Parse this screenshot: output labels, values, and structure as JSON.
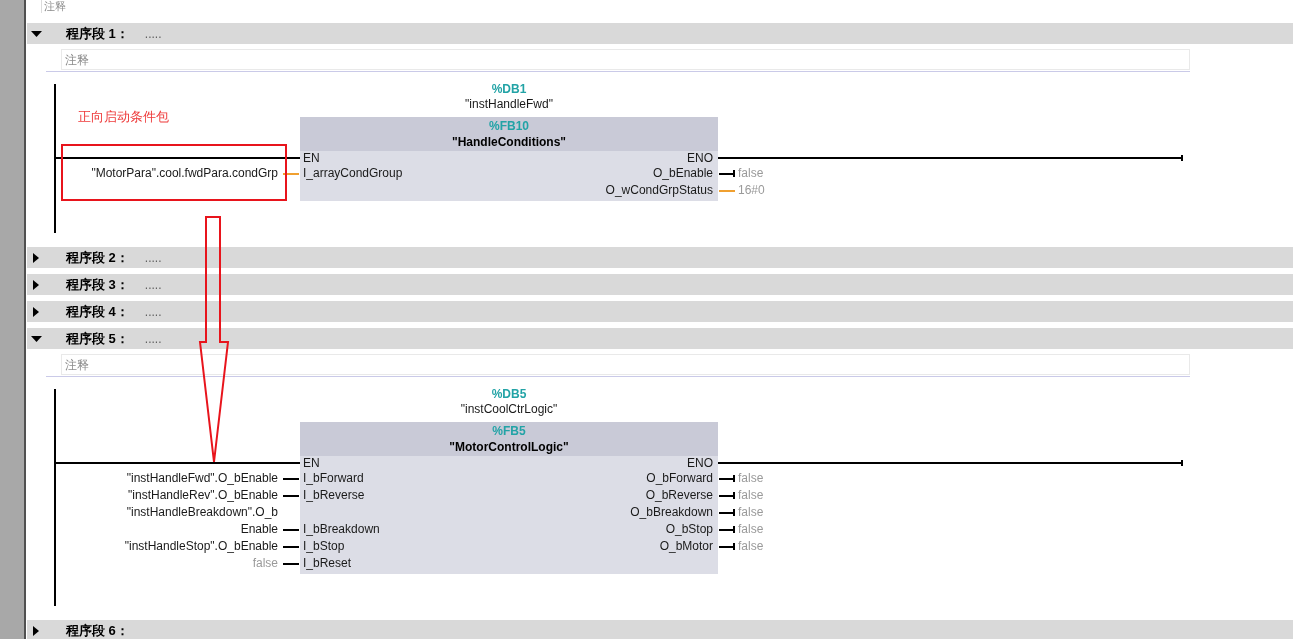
{
  "top_comment": {
    "placeholder": "注释"
  },
  "networks": [
    {
      "title": "程序段 1：",
      "comment_dots": ".....",
      "expanded": true,
      "comment": {
        "placeholder": "注释"
      },
      "block": {
        "instance": "%DB1",
        "instance_name": "\"instHandleFwd\"",
        "type": "%FB10",
        "name": "\"HandleConditions\"",
        "en": "EN",
        "eno": "ENO",
        "inputs": [
          {
            "kind": "complex",
            "constant": false,
            "operand_lines": [
              "\"MotorPara\".cool.fwdPara.condGrp"
            ],
            "pin": "I_arrayCondGroup"
          }
        ],
        "outputs": [
          {
            "kind": "bool",
            "pin": "O_bEnable",
            "value": "false"
          },
          {
            "kind": "complex",
            "pin": "O_wCondGrpStatus",
            "value": "16#0"
          }
        ]
      }
    },
    {
      "title": "程序段 2：",
      "comment_dots": ".....",
      "expanded": false
    },
    {
      "title": "程序段 3：",
      "comment_dots": ".....",
      "expanded": false
    },
    {
      "title": "程序段 4：",
      "comment_dots": ".....",
      "expanded": false
    },
    {
      "title": "程序段 5：",
      "comment_dots": ".....",
      "expanded": true,
      "comment": {
        "placeholder": "注释"
      },
      "block": {
        "instance": "%DB5",
        "instance_name": "\"instCoolCtrLogic\"",
        "type": "%FB5",
        "name": "\"MotorControlLogic\"",
        "en": "EN",
        "eno": "ENO",
        "inputs": [
          {
            "kind": "bool",
            "constant": false,
            "operand_lines": [
              "\"instHandleFwd\".O_bEnable"
            ],
            "pin": "I_bForward"
          },
          {
            "kind": "bool",
            "constant": false,
            "operand_lines": [
              "\"instHandleRev\".O_bEnable"
            ],
            "pin": "I_bReverse"
          },
          {
            "kind": "bool",
            "constant": false,
            "operand_lines": [
              "\"instHandleBreakdown\".O_b",
              "Enable"
            ],
            "pin": "I_bBreakdown"
          },
          {
            "kind": "bool",
            "constant": false,
            "operand_lines": [
              "\"instHandleStop\".O_bEnable"
            ],
            "pin": "I_bStop"
          },
          {
            "kind": "bool",
            "constant": true,
            "operand_lines": [
              "false"
            ],
            "pin": "I_bReset"
          }
        ],
        "outputs": [
          {
            "kind": "bool",
            "pin": "O_bForward",
            "value": "false"
          },
          {
            "kind": "bool",
            "pin": "O_bReverse",
            "value": "false"
          },
          {
            "kind": "bool",
            "pin": "O_bBreakdown",
            "value": "false"
          },
          {
            "kind": "bool",
            "pin": "O_bStop",
            "value": "false"
          },
          {
            "kind": "bool",
            "pin": "O_bMotor",
            "value": "false"
          }
        ]
      }
    },
    {
      "title": "程序段 6：",
      "expanded": false
    }
  ],
  "annotation": {
    "label": "正向启动条件包"
  }
}
